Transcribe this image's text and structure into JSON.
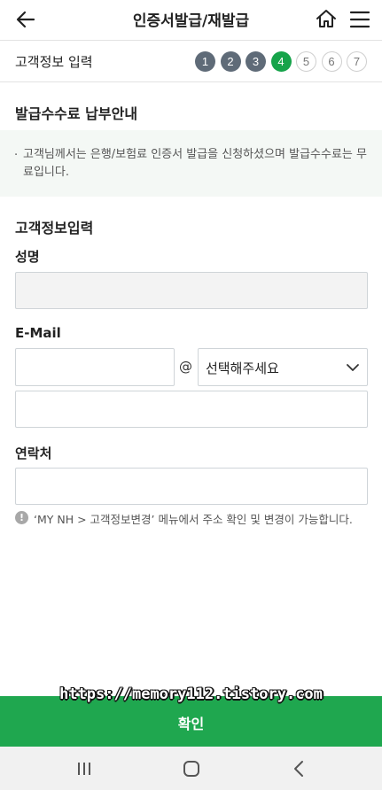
{
  "header": {
    "title": "인증서발급/재발급",
    "back_icon": "back-arrow-icon",
    "home_icon": "home-icon",
    "menu_icon": "hamburger-menu-icon"
  },
  "stepbar": {
    "label": "고객정보 입력",
    "steps": [
      "1",
      "2",
      "3",
      "4",
      "5",
      "6",
      "7"
    ],
    "current_step": 4
  },
  "fee_section": {
    "title": "발급수수료 납부안내",
    "bullet": "·",
    "notice": "고객님께서는 은행/보험료 인증서 발급을 신청하셨으며 발급수수료는 무료입니다."
  },
  "form": {
    "title": "고객정보입력",
    "name_label": "성명",
    "name_value": "",
    "email_label": "E-Mail",
    "email_id_value": "",
    "at_sign": "@",
    "domain_select": "선택해주세요",
    "email_domain_value": "",
    "contact_label": "연락처",
    "contact_value": "",
    "info_icon_text": "!",
    "info_text": "‘MY NH > 고객정보변경’ 메뉴에서 주소 확인 및 변경이 가능합니다."
  },
  "watermark": "https://memory112.tistory.com",
  "confirm_button": "확인",
  "colors": {
    "accent": "#1fa74f",
    "step_done": "#5f6b78",
    "step_active": "#16a34a",
    "notice_bg": "#f4f8f5"
  }
}
